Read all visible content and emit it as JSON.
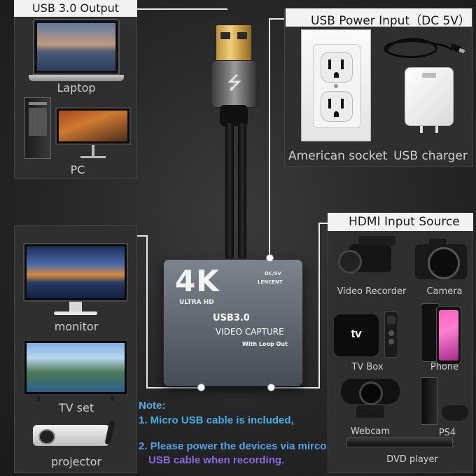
{
  "usb_output": {
    "title": "USB 3.0 Output",
    "laptop_label": "Laptop",
    "pc_label": "PC"
  },
  "usb_power": {
    "title": "USB Power Input（DC 5V）",
    "socket_label": "American socket",
    "charger_label": "USB charger"
  },
  "hdmi_input": {
    "title": "HDMI Input Source",
    "items": [
      {
        "label": "Video Recorder"
      },
      {
        "label": "Camera"
      },
      {
        "label": "TV Box"
      },
      {
        "label": "Phone"
      },
      {
        "label": "Webcam"
      },
      {
        "label": "PS4"
      },
      {
        "label": "DVD player"
      }
    ]
  },
  "outputs": {
    "monitor_label": "monitor",
    "tvset_label": "TV set",
    "projector_label": "projector"
  },
  "device": {
    "badge": "4K",
    "badge_sub": "ULTRA HD",
    "power_text": "DC/5V",
    "brand": "LENCENT",
    "model": "USB3.0",
    "name": "VIDEO CAPTURE",
    "feature": "With Loop Out"
  },
  "tv_box_brand": "tv",
  "note": {
    "title": "Note:",
    "line1": "1. Micro USB cable is included,",
    "line2a": "2. Please power the devices via mirco",
    "line2b": "USB cable when recording."
  },
  "colors": {
    "note_title": "#5aa8e0",
    "note_gradient_start": "#3fb6e8",
    "note_gradient_end": "#9a62e0",
    "panel": "#2f2f2f",
    "header": "#f2f2f2"
  }
}
